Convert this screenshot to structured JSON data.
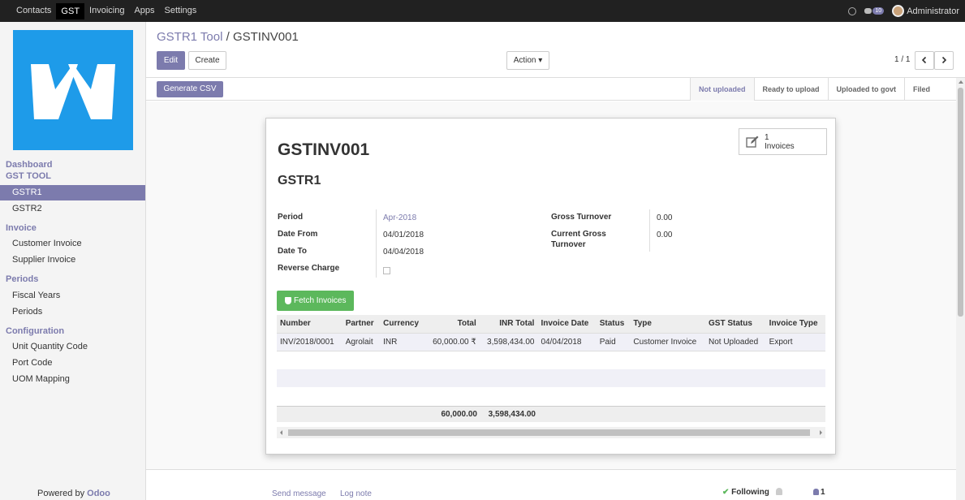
{
  "topnav": {
    "items": [
      "Contacts",
      "GST",
      "Invoicing",
      "Apps",
      "Settings"
    ],
    "active": "GST",
    "chat_count": "10",
    "user": "Administrator"
  },
  "sidebar": {
    "dashboard": "Dashboard",
    "gst_tool": "GST TOOL",
    "gstr1": "GSTR1",
    "gstr2": "GSTR2",
    "invoice_head": "Invoice",
    "customer_invoice": "Customer Invoice",
    "supplier_invoice": "Supplier Invoice",
    "periods_head": "Periods",
    "fiscal_years": "Fiscal Years",
    "periods": "Periods",
    "config_head": "Configuration",
    "unit_quantity_code": "Unit Quantity Code",
    "port_code": "Port Code",
    "uom_mapping": "UOM Mapping",
    "powered_by": "Powered by",
    "brand": "Odoo"
  },
  "breadcrumb": {
    "parent": "GSTR1 Tool",
    "sep": "/",
    "current": "GSTINV001"
  },
  "buttons": {
    "edit": "Edit",
    "create": "Create",
    "action": "Action ▾"
  },
  "pager": {
    "text": "1 / 1"
  },
  "statusbar": {
    "generate_csv": "Generate CSV",
    "stages": [
      "Not uploaded",
      "Ready to upload",
      "Uploaded to govt",
      "Filed"
    ],
    "current_stage": "Not uploaded"
  },
  "form": {
    "smart_count": "1",
    "smart_label": "Invoices",
    "title": "GSTINV001",
    "subtitle": "GSTR1",
    "period_label": "Period",
    "period_value": "Apr-2018",
    "date_from_label": "Date From",
    "date_from_value": "04/01/2018",
    "date_to_label": "Date To",
    "date_to_value": "04/04/2018",
    "reverse_charge_label": "Reverse Charge",
    "gross_turnover_label": "Gross Turnover",
    "gross_turnover_value": "0.00",
    "current_gross_label_1": "Current Gross",
    "current_gross_label_2": "Turnover",
    "current_gross_value": "0.00",
    "fetch_label": "Fetch Invoices"
  },
  "table": {
    "headers": [
      "Number",
      "Partner",
      "Currency",
      "Total",
      "INR Total",
      "Invoice Date",
      "Status",
      "Type",
      "GST Status",
      "Invoice Type"
    ],
    "rows": [
      [
        "INV/2018/0001",
        "Agrolait",
        "INR",
        "60,000.00 ₹",
        "3,598,434.00",
        "04/04/2018",
        "Paid",
        "Customer Invoice",
        "Not Uploaded",
        "Export"
      ]
    ],
    "footer_total": "60,000.00",
    "footer_inr_total": "3,598,434.00"
  },
  "chatter": {
    "send_message": "Send message",
    "log_note": "Log note",
    "following": "Following",
    "followers": "1"
  }
}
